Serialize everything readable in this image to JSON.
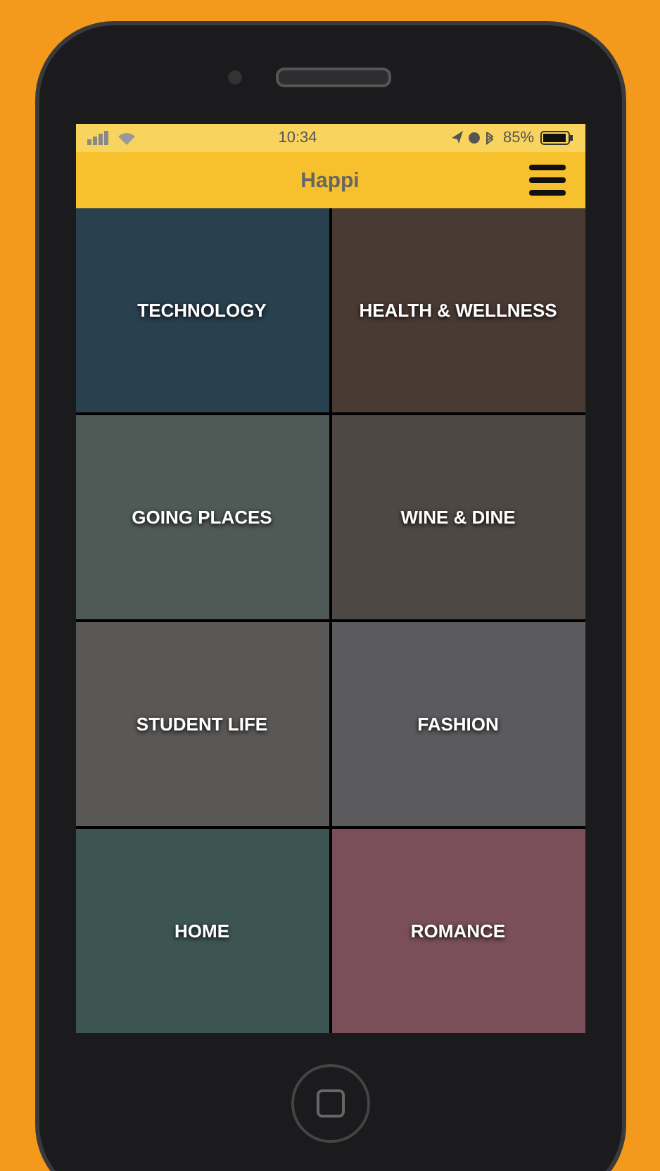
{
  "status_bar": {
    "time": "10:34",
    "battery": "85%"
  },
  "header": {
    "title": "Happi"
  },
  "categories": [
    {
      "label": "TECHNOLOGY"
    },
    {
      "label": "HEALTH & WELLNESS"
    },
    {
      "label": "GOING PLACES"
    },
    {
      "label": "WINE & DINE"
    },
    {
      "label": "STUDENT LIFE"
    },
    {
      "label": "FASHION"
    },
    {
      "label": "HOME"
    },
    {
      "label": "ROMANCE"
    }
  ]
}
